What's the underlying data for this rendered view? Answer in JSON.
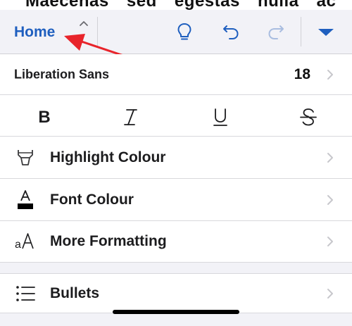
{
  "document": {
    "visible_text": "Maecenas sed egestas nulla ac"
  },
  "toolbar": {
    "tab_label": "Home",
    "icons": [
      "chevron-up-icon",
      "lightbulb-icon",
      "undo-icon",
      "redo-icon",
      "dropdown-triangle-icon"
    ],
    "accent_color": "#1f5fbf"
  },
  "font_row": {
    "font_name": "Liberation Sans",
    "font_size": "18"
  },
  "format_buttons": [
    "bold",
    "italic",
    "underline",
    "strikethrough"
  ],
  "menu": {
    "items": [
      {
        "label": "Highlight Colour",
        "icon": "highlighter-icon"
      },
      {
        "label": "Font Colour",
        "icon": "font-colour-icon"
      },
      {
        "label": "More Formatting",
        "icon": "more-formatting-icon"
      },
      {
        "label": "Bullets",
        "icon": "bullets-icon"
      }
    ]
  },
  "annotation": {
    "arrow_color": "#e8242b"
  }
}
